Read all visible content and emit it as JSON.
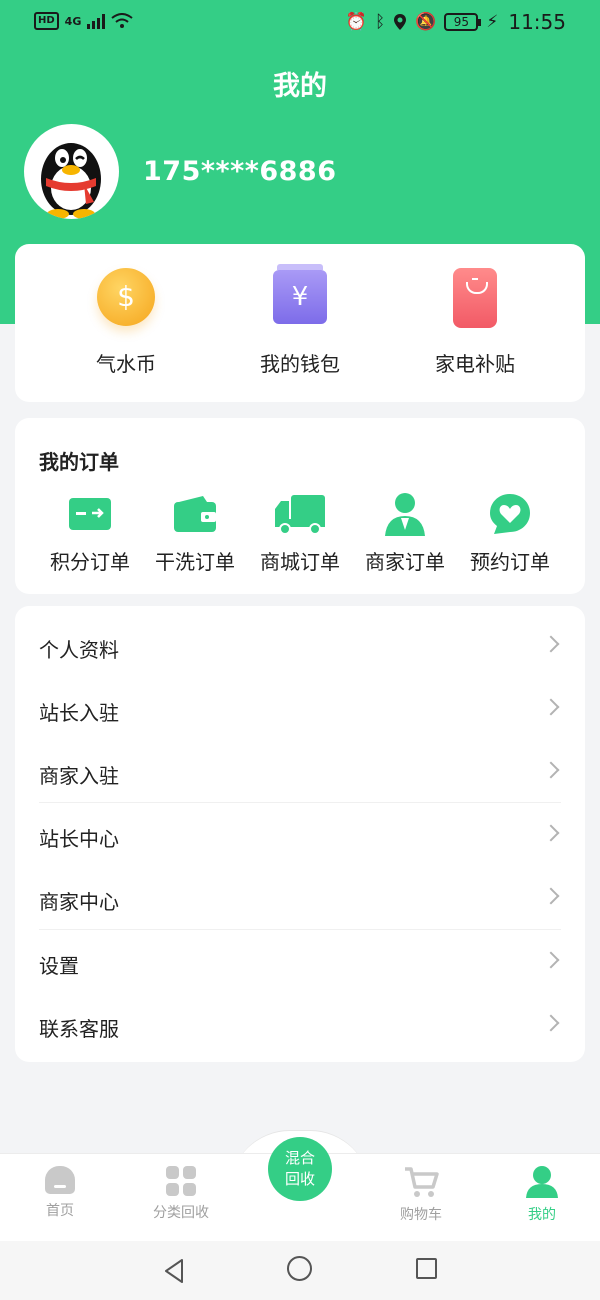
{
  "status_bar": {
    "hd": "HD",
    "network": "4G",
    "battery": "95",
    "time": "11:55"
  },
  "header": {
    "title": "我的",
    "phone": "175****6886"
  },
  "wallet": [
    {
      "label": "气水币",
      "icon": "coin-icon"
    },
    {
      "label": "我的钱包",
      "icon": "wallet-icon"
    },
    {
      "label": "家电补贴",
      "icon": "red-packet-icon"
    }
  ],
  "orders": {
    "title": "我的订单",
    "items": [
      {
        "label": "积分订单",
        "icon": "card-icon"
      },
      {
        "label": "干洗订单",
        "icon": "wallet-icon"
      },
      {
        "label": "商城订单",
        "icon": "truck-icon"
      },
      {
        "label": "商家订单",
        "icon": "person-icon"
      },
      {
        "label": "预约订单",
        "icon": "heart-chat-icon"
      }
    ]
  },
  "menu": [
    {
      "label": "个人资料"
    },
    {
      "label": "站长入驻"
    },
    {
      "label": "商家入驻"
    },
    {
      "label": "站长中心"
    },
    {
      "label": "商家中心"
    },
    {
      "label": "设置"
    },
    {
      "label": "联系客服"
    }
  ],
  "bottom_nav": {
    "items": [
      {
        "label": "首页",
        "icon": "home-icon"
      },
      {
        "label": "分类回收",
        "icon": "grid-icon"
      },
      {
        "label": "购物车",
        "icon": "cart-icon"
      },
      {
        "label": "我的",
        "icon": "person-icon",
        "active": true
      }
    ],
    "center": {
      "line1": "混合",
      "line2": "回收"
    }
  },
  "colors": {
    "primary": "#34ce86",
    "background": "#f3f4f6"
  }
}
